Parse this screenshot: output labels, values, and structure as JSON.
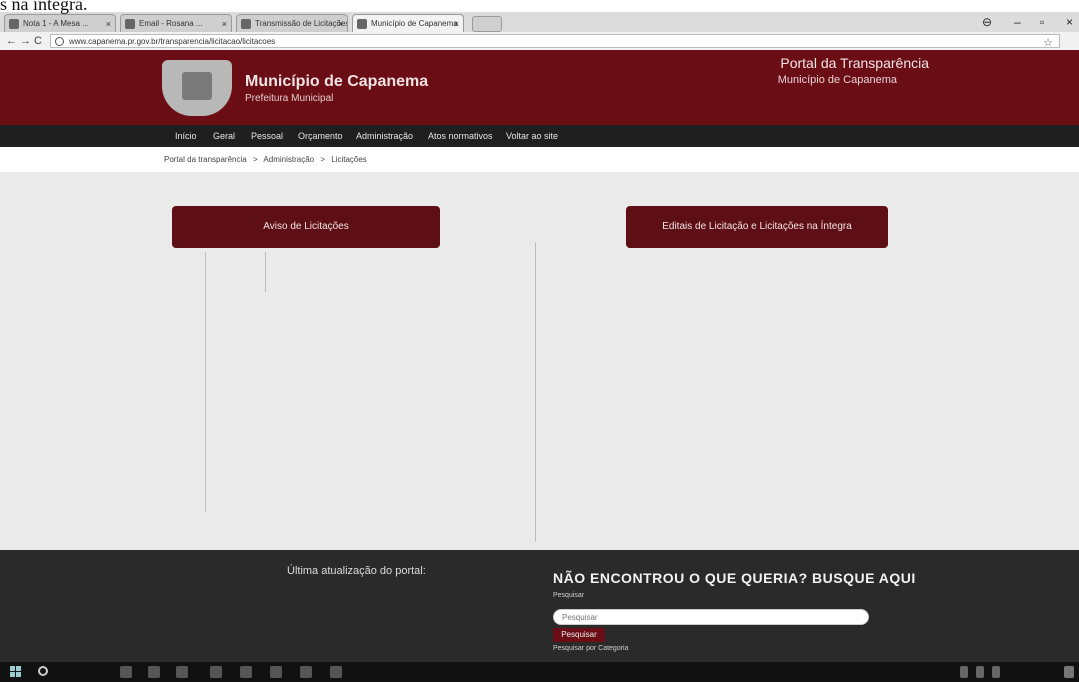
{
  "caption": {
    "text": "s na íntegra."
  },
  "browser": {
    "tabs": [
      {
        "label": "Nota 1 - A Mesa ..."
      },
      {
        "label": "Email - Rosana ..."
      },
      {
        "label": "Transmissão de Licitações"
      },
      {
        "label": "Município de Capanema"
      }
    ],
    "url": "www.capanema.pr.gov.br/transparencia/licitacao/licitacoes"
  },
  "site": {
    "title": "Município de Capanema",
    "subtitle": "Prefeitura Municipal",
    "portal_title": "Portal da Transparência",
    "portal_subtitle": "Município de Capanema"
  },
  "nav": [
    "Início",
    "Geral",
    "Pessoal",
    "Orçamento",
    "Administração",
    "Atos normativos",
    "Voltar ao site"
  ],
  "breadcrumb": [
    "Portal da transparência",
    ">",
    "Administração",
    ">",
    "Licitações"
  ],
  "main": {
    "button_left": "Aviso de Licitações",
    "button_right": "Editais de Licitação e Licitações na Íntegra"
  },
  "footer": {
    "last_update": "Última atualização do portal:",
    "search_heading": "NÃO ENCONTROU O QUE QUERIA? BUSQUE AQUI",
    "search_label": "Pesquisar",
    "search_placeholder": "Pesquisar",
    "search_button": "Pesquisar",
    "search_category": "Pesquisar por Categoria"
  },
  "colors": {
    "brand": "#6a0d14",
    "nav": "#1f1f1f",
    "footer": "#2a2a2a"
  }
}
